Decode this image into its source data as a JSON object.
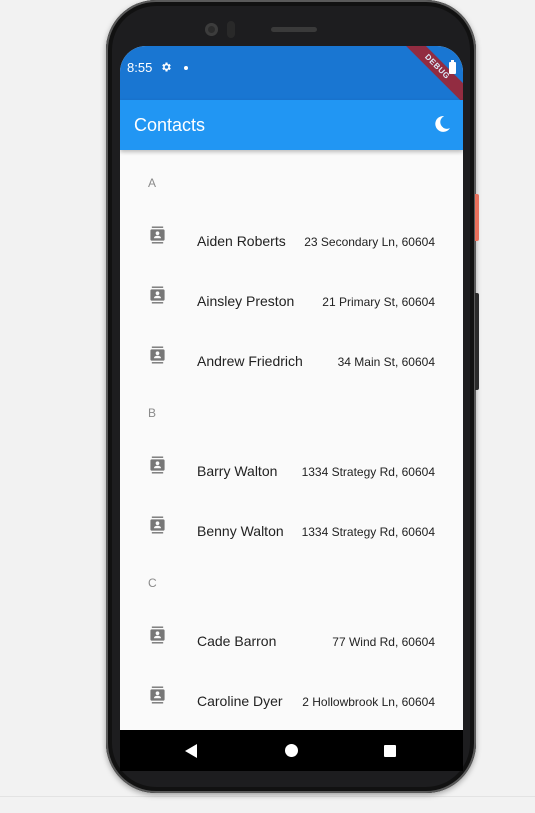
{
  "status_bar": {
    "time": "8:55",
    "debug_banner": "DEBUG"
  },
  "app_bar": {
    "title": "Contacts",
    "theme_icon": "moon-icon"
  },
  "colors": {
    "status_bar": "#1976d2",
    "app_bar": "#2196f3",
    "background": "#fafafa"
  },
  "sections": [
    {
      "header": "A",
      "contacts": [
        {
          "name": "Aiden Roberts",
          "address": "23 Secondary Ln, 60604"
        },
        {
          "name": "Ainsley Preston",
          "address": "21 Primary St, 60604"
        },
        {
          "name": "Andrew Friedrich",
          "address": "34 Main St, 60604"
        }
      ]
    },
    {
      "header": "B",
      "contacts": [
        {
          "name": "Barry Walton",
          "address": "1334 Strategy Rd, 60604"
        },
        {
          "name": "Benny Walton",
          "address": "1334 Strategy Rd, 60604"
        }
      ]
    },
    {
      "header": "C",
      "contacts": [
        {
          "name": "Cade Barron",
          "address": "77 Wind Rd, 60604"
        },
        {
          "name": "Caroline Dyer",
          "address": "2 Hollowbrook Ln, 60604"
        }
      ]
    }
  ],
  "nav_bar": {
    "back": "back-icon",
    "home": "home-icon",
    "recents": "recents-icon"
  }
}
